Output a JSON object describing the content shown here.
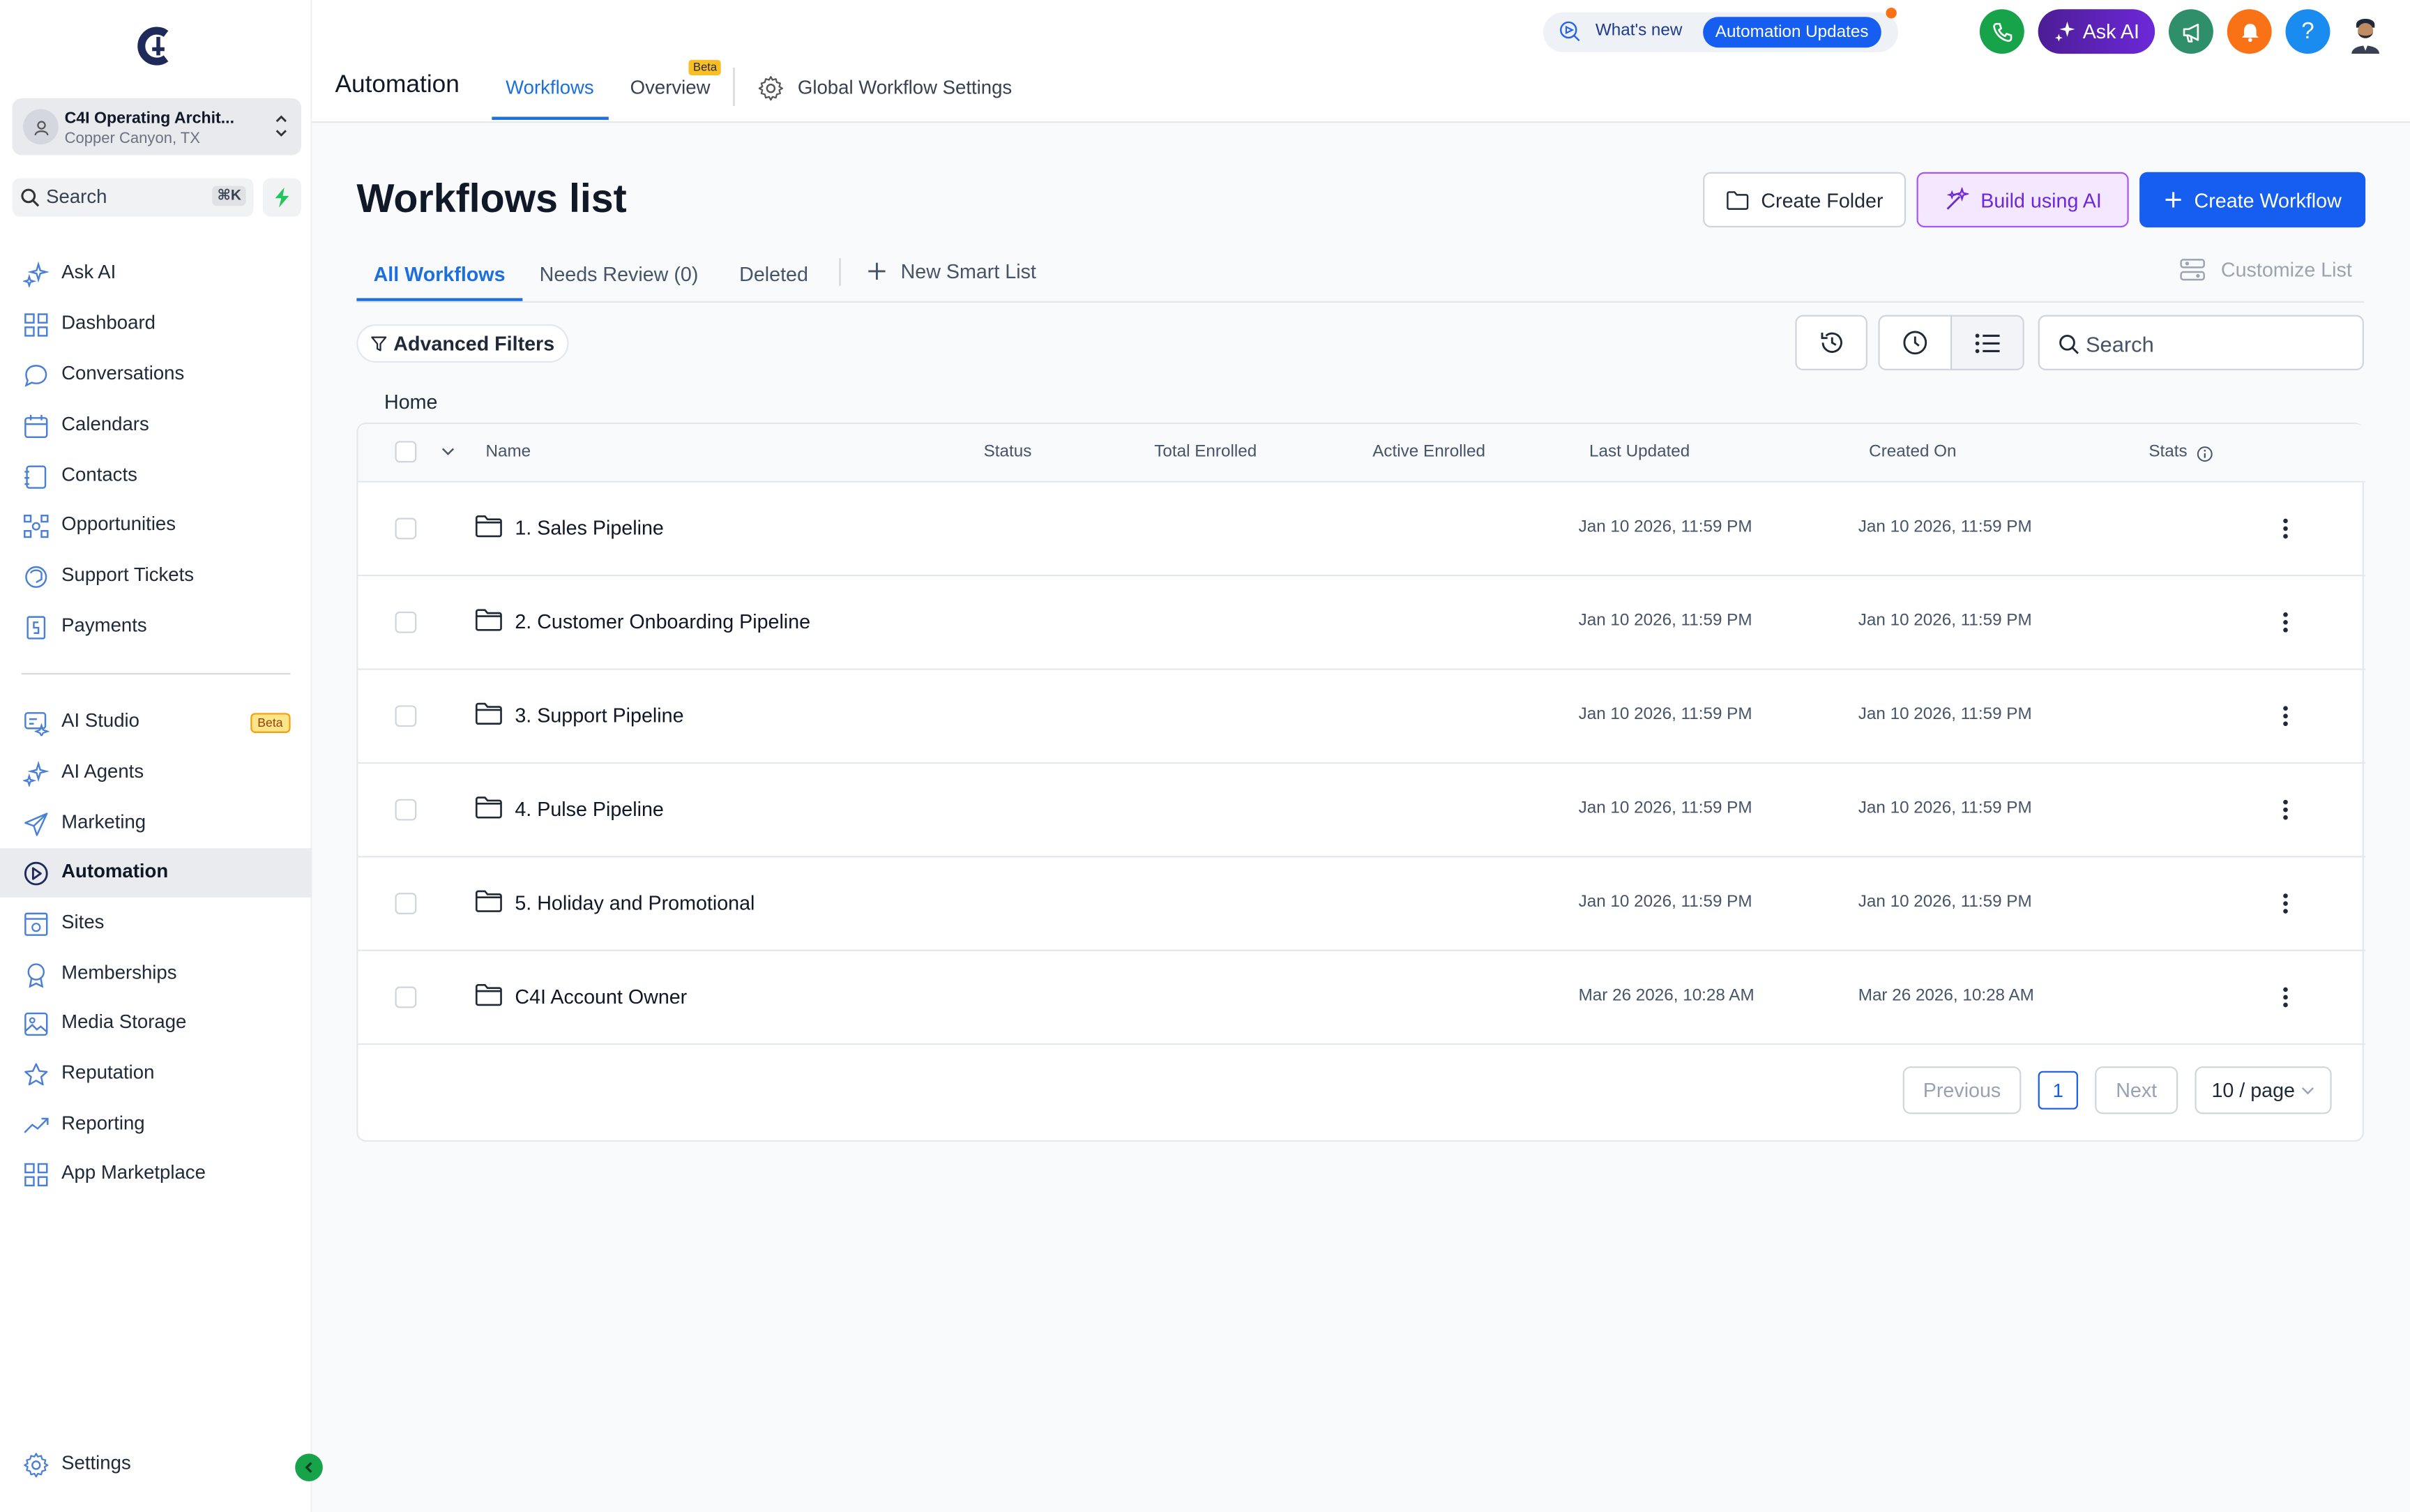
{
  "sidebar": {
    "location": {
      "name": "C4I Operating Archit...",
      "sub": "Copper Canyon, TX"
    },
    "search_label": "Search",
    "search_shortcut": "⌘K",
    "items_top": [
      {
        "label": "Ask AI",
        "icon": "sparkle-icon"
      },
      {
        "label": "Dashboard",
        "icon": "dashboard-icon"
      },
      {
        "label": "Conversations",
        "icon": "chat-icon"
      },
      {
        "label": "Calendars",
        "icon": "calendar-icon"
      },
      {
        "label": "Contacts",
        "icon": "contacts-icon"
      },
      {
        "label": "Opportunities",
        "icon": "opportunities-icon"
      },
      {
        "label": "Support Tickets",
        "icon": "ticket-icon"
      },
      {
        "label": "Payments",
        "icon": "payments-icon"
      }
    ],
    "items_bottom": [
      {
        "label": "AI Studio",
        "icon": "ai-studio-icon",
        "badge": "Beta"
      },
      {
        "label": "AI Agents",
        "icon": "sparkle-icon"
      },
      {
        "label": "Marketing",
        "icon": "send-icon"
      },
      {
        "label": "Automation",
        "icon": "automation-icon",
        "active": true
      },
      {
        "label": "Sites",
        "icon": "sites-icon"
      },
      {
        "label": "Memberships",
        "icon": "membership-icon"
      },
      {
        "label": "Media Storage",
        "icon": "image-icon"
      },
      {
        "label": "Reputation",
        "icon": "star-icon"
      },
      {
        "label": "Reporting",
        "icon": "trend-icon"
      },
      {
        "label": "App Marketplace",
        "icon": "grid-icon"
      }
    ],
    "settings_label": "Settings"
  },
  "header": {
    "title": "Automation",
    "tabs": [
      {
        "label": "Workflows",
        "active": true
      },
      {
        "label": "Overview",
        "badge": "Beta"
      }
    ],
    "global_settings_label": "Global Workflow Settings",
    "whats_new_label": "What's new",
    "updates_pill": "Automation Updates",
    "ask_ai_label": "Ask AI",
    "help_label": "?"
  },
  "main": {
    "title": "Workflows list",
    "buttons": {
      "create_folder": "Create Folder",
      "build_ai": "Build using AI",
      "create_workflow": "Create Workflow"
    },
    "sub_tabs": [
      {
        "label": "All Workflows",
        "active": true
      },
      {
        "label": "Needs Review (0)"
      },
      {
        "label": "Deleted"
      }
    ],
    "new_smart_list": "New Smart List",
    "customize_list": "Customize List",
    "advanced_filters": "Advanced Filters",
    "search_placeholder": "Search",
    "breadcrumb": "Home"
  },
  "table": {
    "columns": [
      "Name",
      "Status",
      "Total Enrolled",
      "Active Enrolled",
      "Last Updated",
      "Created On",
      "Stats"
    ],
    "rows": [
      {
        "name": "1. Sales Pipeline",
        "last_updated": "Jan 10 2026, 11:59 PM",
        "created_on": "Jan 10 2026, 11:59 PM"
      },
      {
        "name": "2. Customer Onboarding Pipeline",
        "last_updated": "Jan 10 2026, 11:59 PM",
        "created_on": "Jan 10 2026, 11:59 PM"
      },
      {
        "name": "3. Support Pipeline",
        "last_updated": "Jan 10 2026, 11:59 PM",
        "created_on": "Jan 10 2026, 11:59 PM"
      },
      {
        "name": "4. Pulse Pipeline",
        "last_updated": "Jan 10 2026, 11:59 PM",
        "created_on": "Jan 10 2026, 11:59 PM"
      },
      {
        "name": "5. Holiday and Promotional",
        "last_updated": "Jan 10 2026, 11:59 PM",
        "created_on": "Jan 10 2026, 11:59 PM"
      },
      {
        "name": "C4I Account Owner",
        "last_updated": "Mar 26 2026, 10:28 AM",
        "created_on": "Mar 26 2026, 10:28 AM"
      }
    ]
  },
  "pagination": {
    "previous": "Previous",
    "current_page": "1",
    "next": "Next",
    "page_size": "10 / page"
  },
  "colors": {
    "primary": "#155eef",
    "tab_active": "#1d6fdc",
    "phone": "#16a34a",
    "megaphone": "#2f8f6b",
    "bell": "#f97316",
    "help": "#1a8cf0",
    "ai_purple": "#6d28d9"
  }
}
